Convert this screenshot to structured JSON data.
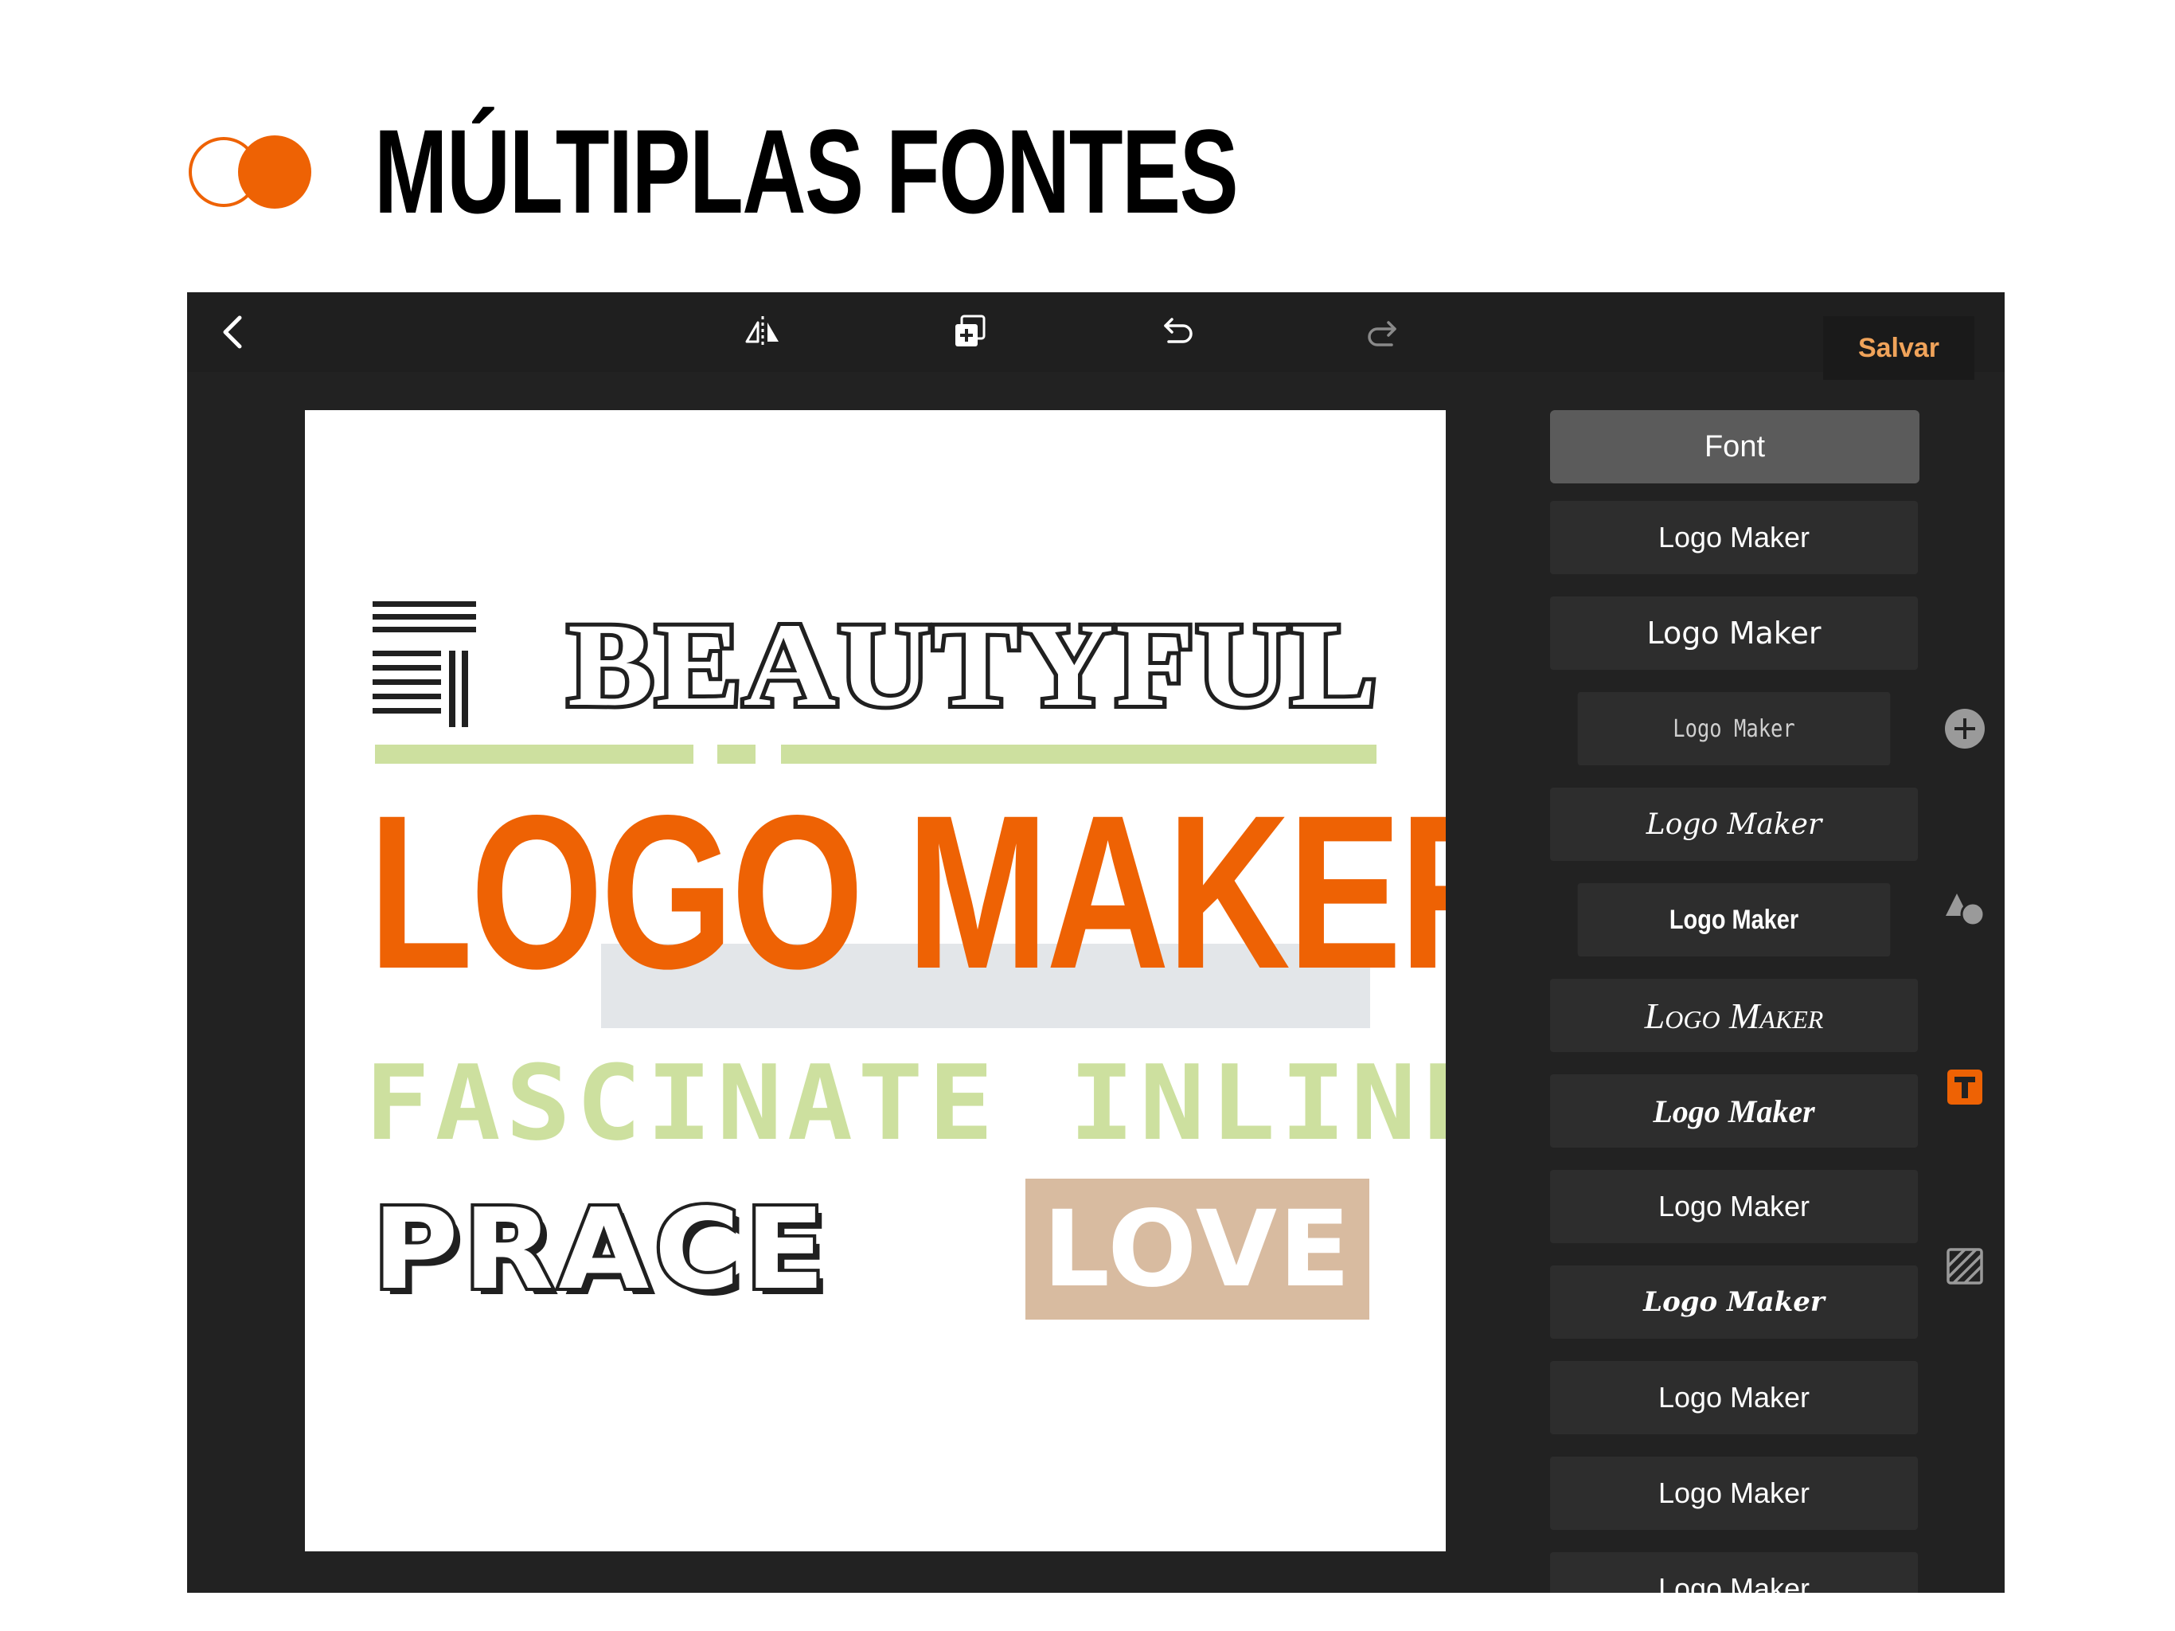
{
  "header": {
    "title": "MÚLTIPLAS FONTES"
  },
  "toolbar": {
    "save_label": "Salvar"
  },
  "canvas": {
    "line1": "BEAUTYFUL",
    "line2": "LOGO MAKER",
    "line3": "FASCINATE INLINE",
    "line4": "PRACE",
    "badge": "LOVE"
  },
  "font_panel": {
    "header": "Font",
    "items": [
      "Logo Maker",
      "Logo Maker",
      "Logo Maker",
      "Logo Maker",
      "Logo Maker",
      "Logo Maker",
      "Logo Maker",
      "Logo Maker",
      "Logo Maker",
      "Logo Maker",
      "Logo Maker",
      "Logo Maker"
    ]
  },
  "colors": {
    "accent": "#ee6204",
    "save": "#f0a35a",
    "green": "#cde09f",
    "tan": "#d8bba0",
    "panel": "#222222"
  }
}
